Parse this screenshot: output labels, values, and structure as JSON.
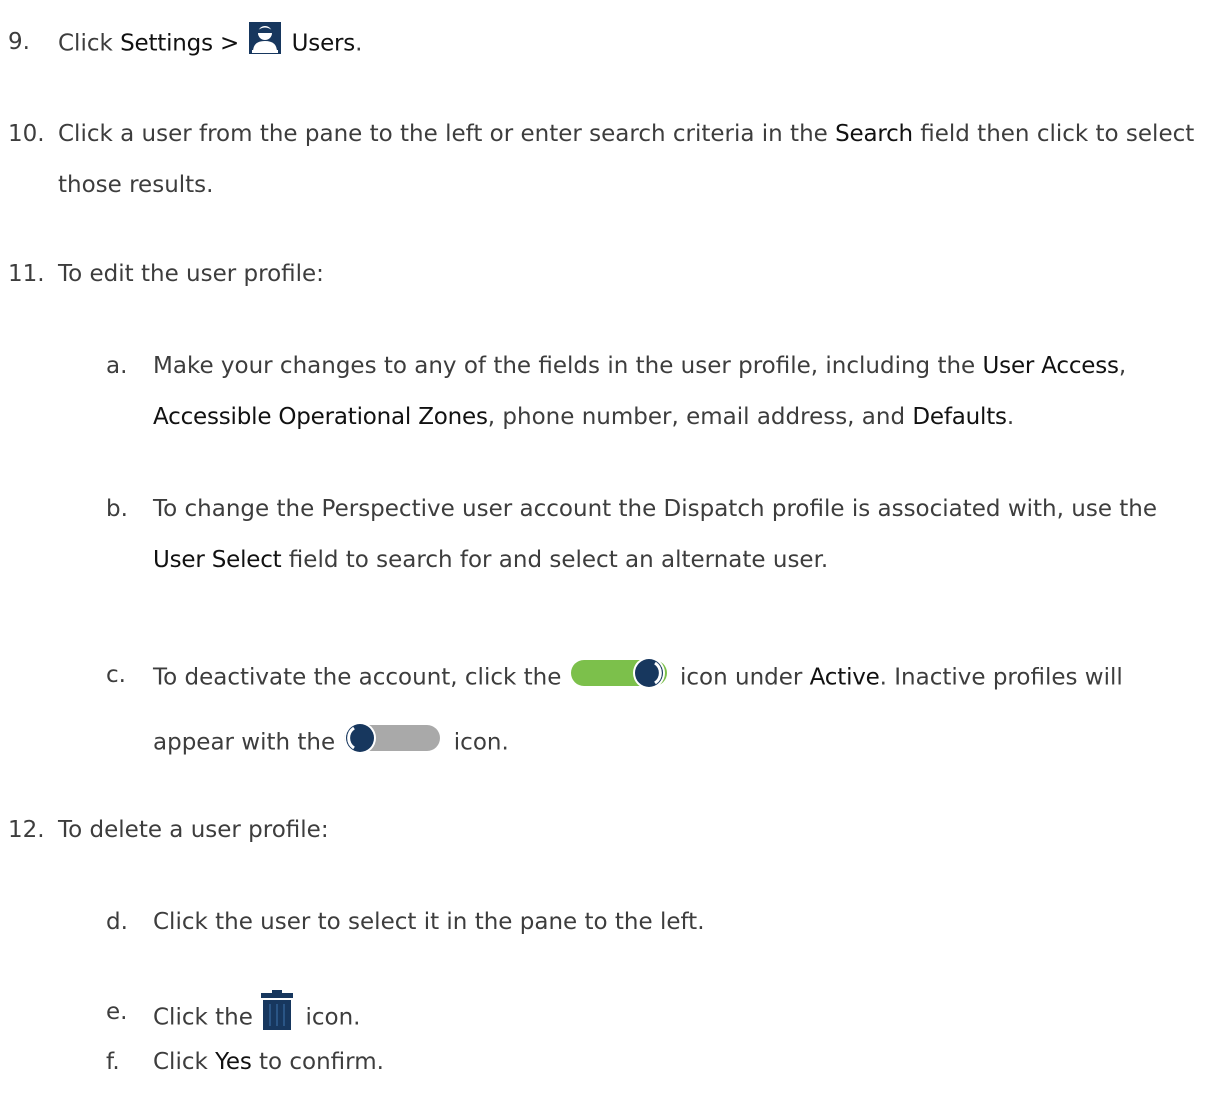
{
  "step9": {
    "num": "9.",
    "t1": "Click ",
    "b1": "Settings >",
    "b2": "Users",
    "t2": ".",
    "icon": "user-icon"
  },
  "step10": {
    "num": "10.",
    "t1": "Click a user from the pane to the left or enter search criteria in the ",
    "b1": "Search",
    "t2": " field then click to select",
    "t3": "those results."
  },
  "step11": {
    "num": "11.",
    "t1": "To edit the user profile:"
  },
  "subA": {
    "letter": "a.",
    "t1": "Make your changes to any of the fields in the user profile, including the ",
    "b1": "User Access",
    "t2": ",",
    "b2": "Accessible Operational Zones",
    "t3": ", phone number, email address, and ",
    "b3": "Defaults",
    "t4": "."
  },
  "subB": {
    "letter": "b.",
    "t1": "To change the Perspective user account the Dispatch profile is associated with, use the",
    "b1": "User Select",
    "t2": " field to search for and select an alternate user."
  },
  "subC": {
    "letter": "c.",
    "t1": "To deactivate the account, click the ",
    "t2": " icon under ",
    "b1": "Active",
    "t3": ". Inactive profiles will",
    "t4": "appear with the ",
    "t5": " icon.",
    "icon_on": "toggle-on-icon",
    "icon_off": "toggle-off-icon"
  },
  "step12": {
    "num": "12.",
    "t1": "To delete a user profile:"
  },
  "subD": {
    "letter": "d.",
    "t1": "Click the user to select it in the pane to the left."
  },
  "subE": {
    "letter": "e.",
    "t1": "Click the ",
    "t2": " icon.",
    "icon": "trash-icon"
  },
  "subF": {
    "letter": "f.",
    "t1": "Click ",
    "b1": "Yes",
    "t2": " to confirm."
  },
  "colors": {
    "text": "#3d3d3d",
    "emphasis": "#111111",
    "icon_navy": "#17375e",
    "toggle_green": "#7cc04b",
    "toggle_grey": "#a9a9a9"
  }
}
